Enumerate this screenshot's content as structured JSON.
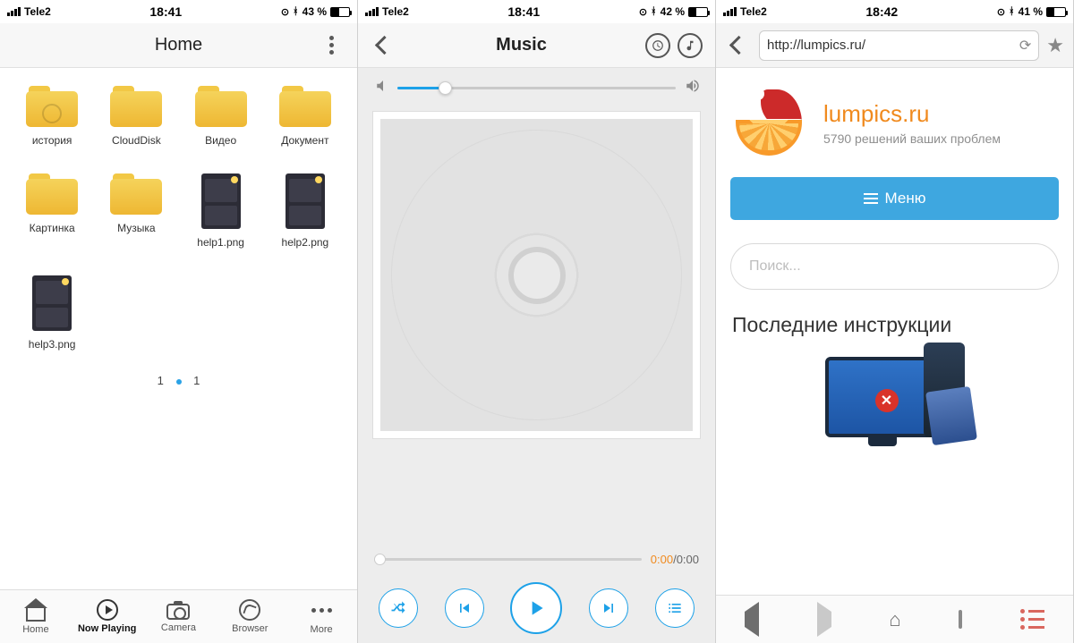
{
  "screen1": {
    "status": {
      "carrier": "Tele2",
      "time": "18:41",
      "battery_pct": "43 %",
      "battery_fill": 43
    },
    "title": "Home",
    "items": [
      {
        "kind": "folder-history",
        "label": "история"
      },
      {
        "kind": "folder",
        "label": "CloudDisk"
      },
      {
        "kind": "folder",
        "label": "Видео"
      },
      {
        "kind": "folder",
        "label": "Документ"
      },
      {
        "kind": "folder",
        "label": "Картинка"
      },
      {
        "kind": "folder",
        "label": "Музыка"
      },
      {
        "kind": "image",
        "label": "help1.png"
      },
      {
        "kind": "image",
        "label": "help2.png"
      },
      {
        "kind": "image",
        "label": "help3.png"
      }
    ],
    "pager": {
      "current": "1",
      "total": "1"
    },
    "tabs": {
      "home": "Home",
      "now_playing": "Now Playing",
      "camera": "Camera",
      "browser": "Browser",
      "more": "More"
    }
  },
  "screen2": {
    "status": {
      "carrier": "Tele2",
      "time": "18:41",
      "battery_pct": "42 %",
      "battery_fill": 42
    },
    "title": "Music",
    "volume_pct": 17,
    "time_current": "0:00",
    "time_total": "/0:00"
  },
  "screen3": {
    "status": {
      "carrier": "Tele2",
      "time": "18:42",
      "battery_pct": "41 %",
      "battery_fill": 41
    },
    "url": "http://lumpics.ru/",
    "brand_title": "lumpics.ru",
    "brand_sub": "5790 решений ваших проблем",
    "menu_label": "Меню",
    "search_placeholder": "Поиск...",
    "section_heading": "Последние инструкции"
  }
}
